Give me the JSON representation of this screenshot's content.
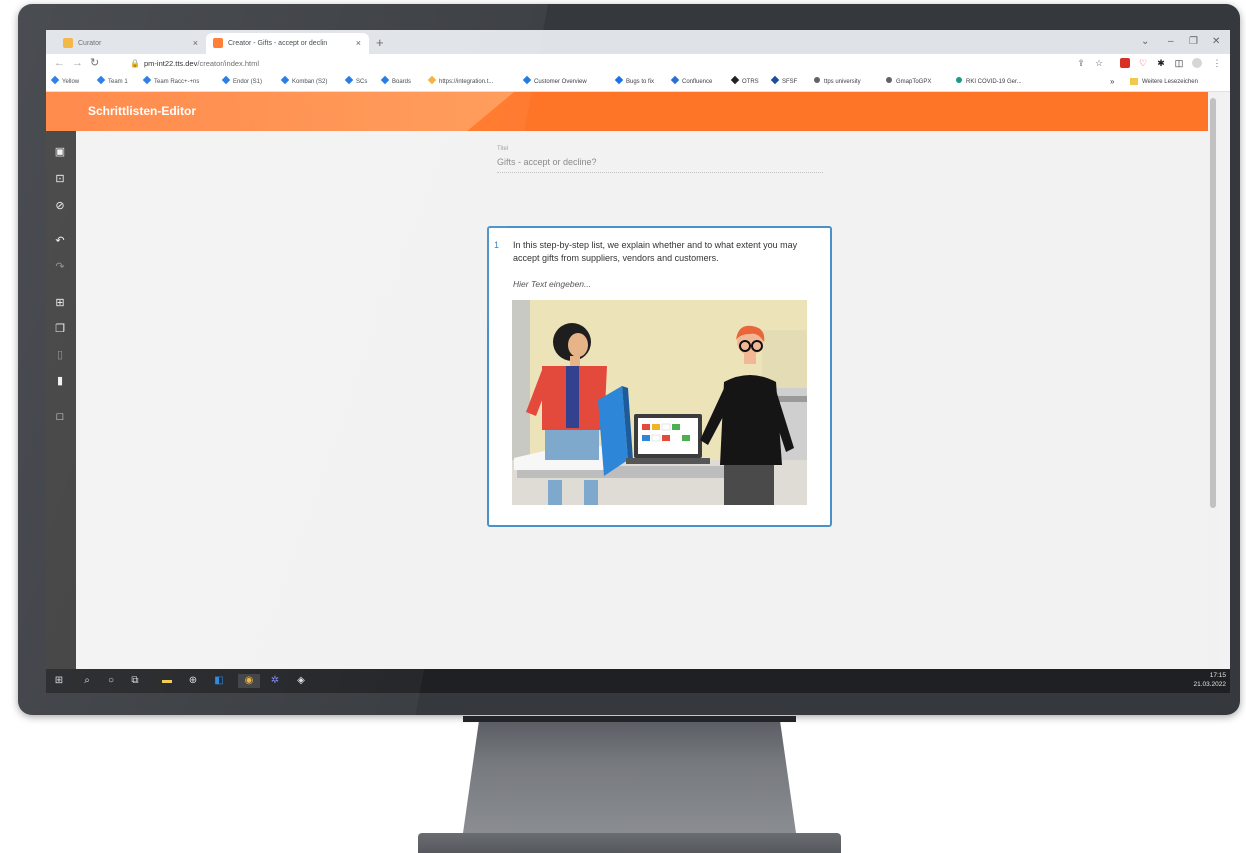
{
  "browser": {
    "tabs": [
      {
        "label": "Curator",
        "close": "×",
        "active": false
      },
      {
        "label": "Creator - Gifts - accept or declin",
        "close": "×",
        "active": true
      }
    ],
    "new_tab": "+",
    "url_host": "pm-int22.tts.dev",
    "url_path": "/creator/index.html",
    "bookmarks": [
      "Yellow",
      "Team 1",
      "Team Racc+-+ns",
      "Endor (S1)",
      "Komban (S2)",
      "SCs",
      "Boards",
      "https://integration.t...",
      "Customer Overview",
      "Bugs to fix",
      "Confluence",
      "OTRS",
      "SFSF",
      "ttps university",
      "GmapToGPX",
      "RKI COVID-19 Ger..."
    ],
    "bookmarks_overflow": "»",
    "other_bookmarks": "Weitere Lesezeichen"
  },
  "app": {
    "title": "Schrittlisten-Editor",
    "toolbar": [
      "save-icon",
      "export-icon",
      "cancel-icon",
      "undo-icon",
      "redo-icon",
      "add-step-icon",
      "copy-icon",
      "paste-icon",
      "delete-icon",
      "select-icon"
    ]
  },
  "editor": {
    "title_label": "Titel",
    "title_value": "Gifts - accept or decline?",
    "steps": [
      {
        "number": "1",
        "text": "In this step-by-step list, we explain whether and to what extent you may accept gifts from suppliers, vendors and customers.",
        "placeholder": "Hier Text eingeben...",
        "image": "illustration-office-workers"
      }
    ]
  },
  "taskbar": {
    "time": "17:15",
    "date": "21.03.2022"
  },
  "colors": {
    "header": "#ff7527",
    "card_border": "#4a90c9",
    "toolbar": "#3a3a3a"
  }
}
